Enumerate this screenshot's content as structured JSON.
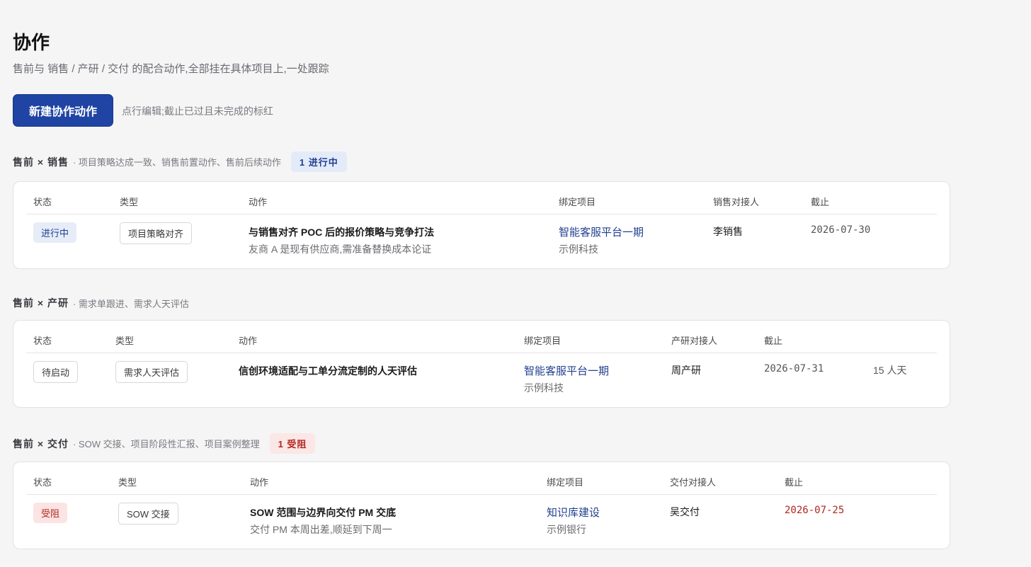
{
  "page": {
    "title": "协作",
    "subtitle": "售前与 销售 / 产研 / 交付 的配合动作,全部挂在具体项目上,一处跟踪",
    "new_button": "新建协作动作",
    "hint": "点行编辑;截止已过且未完成的标红"
  },
  "sections": [
    {
      "team": "售前 × 销售",
      "desc": "· 项目策略达成一致、销售前置动作、售前后续动作",
      "badge": "1 进行中",
      "columns": [
        "状态",
        "类型",
        "动作",
        "绑定项目",
        "销售对接人",
        "截止"
      ],
      "row": {
        "status": "进行中",
        "type": "项目策略对齐",
        "action_title": "与销售对齐 POC 后的报价策略与竞争打法",
        "action_note": "友商 A 是现有供应商,需准备替换成本论证",
        "project": "智能客服平台一期",
        "client": "示例科技",
        "contact": "李销售",
        "due": "2026-07-30"
      }
    },
    {
      "team": "售前 × 产研",
      "desc": "· 需求单跟进、需求人天评估",
      "badge": "",
      "columns": [
        "状态",
        "类型",
        "动作",
        "绑定项目",
        "产研对接人",
        "截止"
      ],
      "row": {
        "status": "待启动",
        "type": "需求人天评估",
        "action_title": "信创环境适配与工单分流定制的人天评估",
        "action_note": "",
        "project": "智能客服平台一期",
        "client": "示例科技",
        "contact": "周产研",
        "due": "2026-07-31",
        "effort": "15 人天"
      }
    },
    {
      "team": "售前 × 交付",
      "desc": "· SOW 交接、项目阶段性汇报、项目案例整理",
      "badge": "1 受阻",
      "columns": [
        "状态",
        "类型",
        "动作",
        "绑定项目",
        "交付对接人",
        "截止"
      ],
      "row": {
        "status": "受阻",
        "type": "SOW 交接",
        "action_title": "SOW 范围与边界向交付 PM 交底",
        "action_note": "交付 PM 本周出差,顺延到下周一",
        "project": "知识库建设",
        "client": "示例银行",
        "contact": "吴交付",
        "due": "2026-07-25"
      }
    }
  ],
  "colors": {
    "primary": "#1f44a3",
    "link": "#1f3f8f",
    "overdue": "#b3261e"
  }
}
